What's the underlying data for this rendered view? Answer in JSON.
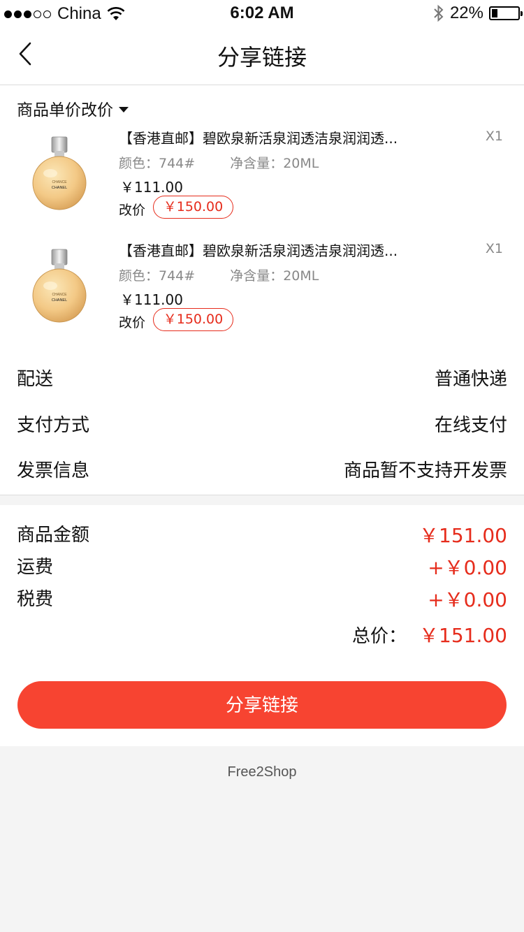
{
  "status_bar": {
    "carrier": "China",
    "time": "6:02 AM",
    "battery": "22%",
    "battery_level": 0.22
  },
  "nav": {
    "title": "分享链接"
  },
  "section": {
    "title": "商品单价改价"
  },
  "products": [
    {
      "name": "【香港直邮】碧欧泉新活泉润透洁泉润润透...",
      "qty": "X1",
      "attr_color": "颜色：744#",
      "attr_volume": "净含量：20ML",
      "price": "￥111.00",
      "change_label": "改价",
      "change_value": "￥150.00",
      "bottle_text1": "CHANCE",
      "bottle_text2": "CHANEL"
    },
    {
      "name": "【香港直邮】碧欧泉新活泉润透洁泉润润透...",
      "qty": "X1",
      "attr_color": "颜色：744#",
      "attr_volume": "净含量：20ML",
      "price": "￥111.00",
      "change_label": "改价",
      "change_value": "￥150.00",
      "bottle_text1": "CHANCE",
      "bottle_text2": "CHANEL"
    }
  ],
  "info": {
    "delivery_label": "配送",
    "delivery_value": "普通快递",
    "payment_label": "支付方式",
    "payment_value": "在线支付",
    "invoice_label": "发票信息",
    "invoice_value": "商品暂不支持开发票"
  },
  "summary": {
    "goods_label": "商品金额",
    "goods_value": "￥151.00",
    "shipping_label": "运费",
    "shipping_value": "+￥0.00",
    "tax_label": "税费",
    "tax_value": "+￥0.00",
    "total_label": "总价：",
    "total_value": "￥151.00"
  },
  "actions": {
    "share_label": "分享链接"
  },
  "footer": {
    "brand": "Free2Shop"
  },
  "colors": {
    "accent": "#f74431",
    "price_red": "#e62c1c"
  }
}
